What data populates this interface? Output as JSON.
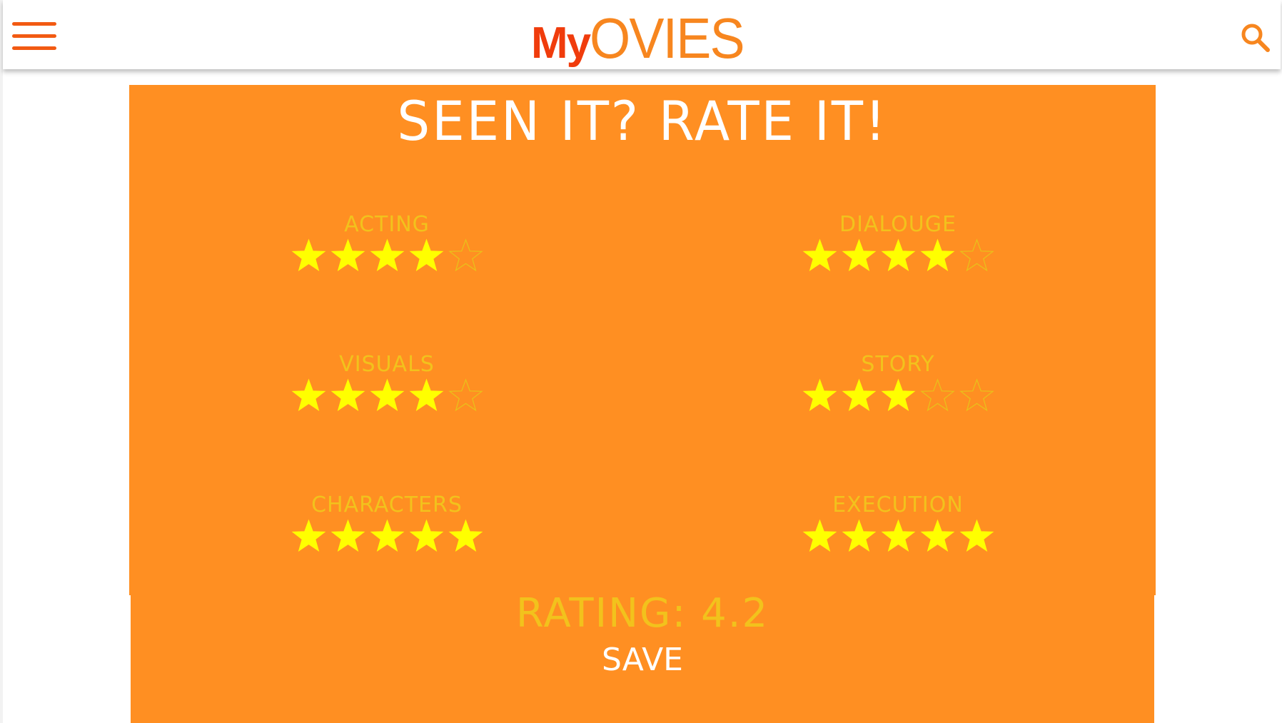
{
  "header": {
    "logo_my": "My",
    "logo_ovies": "OVIES",
    "menu_icon": "hamburger-menu-icon",
    "search_icon": "search-icon"
  },
  "panel": {
    "title": "SEEN IT? RATE IT!",
    "categories": [
      {
        "label": "ACTING",
        "rating": 4,
        "max": 5
      },
      {
        "label": "DIALOUGE",
        "rating": 4,
        "max": 5
      },
      {
        "label": "VISUALS",
        "rating": 4,
        "max": 5
      },
      {
        "label": "STORY",
        "rating": 3,
        "max": 5
      },
      {
        "label": "CHARACTERS",
        "rating": 5,
        "max": 5
      },
      {
        "label": "EXECUTION",
        "rating": 5,
        "max": 5
      }
    ],
    "rating_text": "RATING: 4.2",
    "save_label": "SAVE"
  },
  "colors": {
    "accent": "#ff8f22",
    "logo_red": "#f03c0c",
    "logo_orange": "#f7861f",
    "label_gold": "#f2c21c",
    "star_fill": "#ffff00",
    "star_outline": "#e8c21a"
  }
}
